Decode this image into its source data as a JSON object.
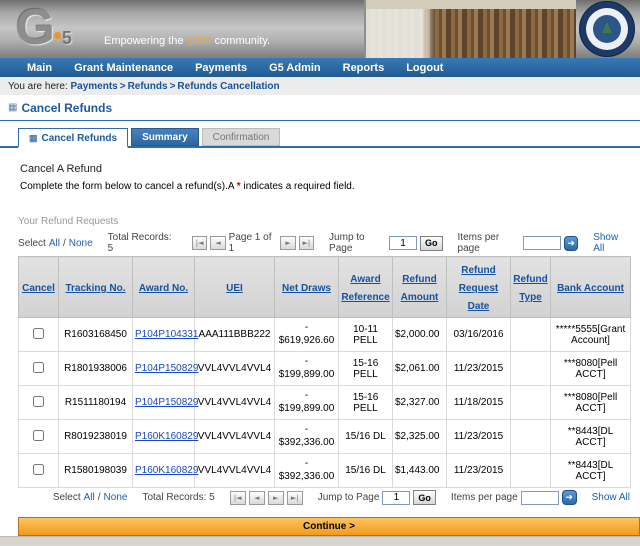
{
  "icons": {
    "page_title": "▦",
    "active_tab": "▦",
    "first_page": "|◄",
    "prev_page": "◄",
    "next_page": "►",
    "last_page": "►|",
    "items_go": "➜"
  },
  "colors": {
    "nav_blue": "#2a68a4",
    "link_blue": "#15519e",
    "accent_orange": "#f2a435",
    "required_red": "#cc0000",
    "continue_orange": "#f29b1d"
  },
  "header": {
    "logo_g": "G",
    "logo_5": "5",
    "tagline_pre": "Empowering the ",
    "tagline_highlight": "grant",
    "tagline_post": " community."
  },
  "nav": {
    "items": [
      "Main",
      "Grant Maintenance",
      "Payments",
      "G5 Admin",
      "Reports",
      "Logout"
    ]
  },
  "breadcrumb": {
    "prefix": "You are here:",
    "separator": ">",
    "items": [
      "Payments",
      "Refunds",
      "Refunds Cancellation"
    ]
  },
  "page": {
    "title": "Cancel Refunds"
  },
  "tabs": {
    "items": [
      {
        "label": "Cancel Refunds"
      },
      {
        "label": "Summary"
      },
      {
        "label": "Confirmation"
      }
    ]
  },
  "content": {
    "section_heading": "Cancel A Refund",
    "instruction_pre": "Complete the form below to cancel a refund(s).A ",
    "required_marker": "*",
    "instruction_post": " indicates a required field.",
    "table_heading": "Your Refund Requests",
    "continue_label": "Continue >"
  },
  "pagination": {
    "select_label": "Select",
    "select_all": "All",
    "select_separator": "/",
    "select_none": "None",
    "total_records": "Total Records: 5",
    "page_text": "Page 1 of 1",
    "jump_label": "Jump to Page",
    "jump_value": "1",
    "go_label": "Go",
    "items_per_page_label": "Items per page",
    "items_per_page_value": "",
    "show_all": "Show All"
  },
  "table": {
    "headers": [
      "Cancel",
      "Tracking No.",
      "Award No.",
      "UEI",
      "Net Draws",
      "Award Reference",
      "Refund Amount",
      "Refund Request Date",
      "Refund Type",
      "Bank Account"
    ],
    "rows": [
      {
        "tracking_no": "R1603168450",
        "award_no": "P104P104331",
        "uei": "AAA111BBB222",
        "net_draws": "-\n$619,926.60",
        "award_reference": "10-11 PELL",
        "refund_amount": "$2,000.00",
        "refund_request_date": "03/16/2016",
        "refund_type": "",
        "bank_account": "*****5555[Grant Account]"
      },
      {
        "tracking_no": "R1801938006",
        "award_no": "P104P150829",
        "uei": "VVL4VVL4VVL4",
        "net_draws": "-\n$199,899.00",
        "award_reference": "15-16 PELL",
        "refund_amount": "$2,061.00",
        "refund_request_date": "11/23/2015",
        "refund_type": "",
        "bank_account": "***8080[Pell ACCT]"
      },
      {
        "tracking_no": "R1511180194",
        "award_no": "P104P150829",
        "uei": "VVL4VVL4VVL4",
        "net_draws": "-\n$199,899.00",
        "award_reference": "15-16 PELL",
        "refund_amount": "$2,327.00",
        "refund_request_date": "11/18/2015",
        "refund_type": "",
        "bank_account": "***8080[Pell ACCT]"
      },
      {
        "tracking_no": "R8019238019",
        "award_no": "P160K160829",
        "uei": "VVL4VVL4VVL4",
        "net_draws": "-\n$392,336.00",
        "award_reference": "15/16 DL",
        "refund_amount": "$2,325.00",
        "refund_request_date": "11/23/2015",
        "refund_type": "",
        "bank_account": "**8443[DL ACCT]"
      },
      {
        "tracking_no": "R1580198039",
        "award_no": "P160K160829",
        "uei": "VVL4VVL4VVL4",
        "net_draws": "-\n$392,336.00",
        "award_reference": "15/16 DL",
        "refund_amount": "$1,443.00",
        "refund_request_date": "11/23/2015",
        "refund_type": "",
        "bank_account": "**8443[DL ACCT]"
      }
    ]
  }
}
